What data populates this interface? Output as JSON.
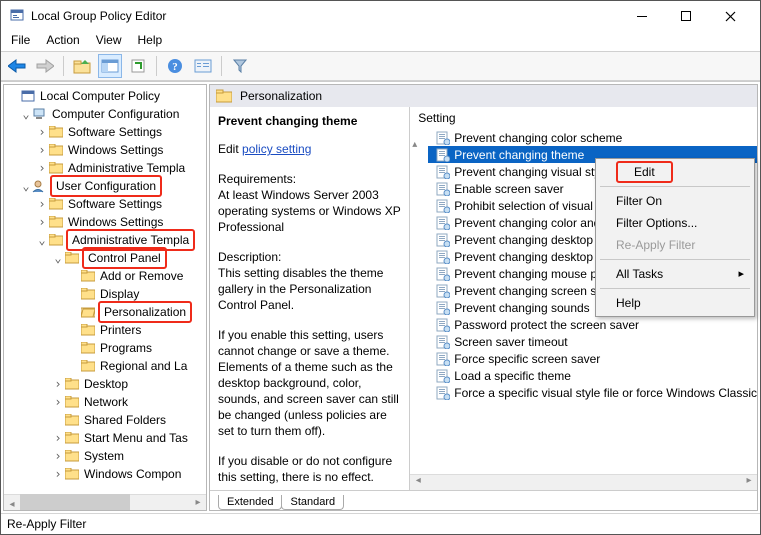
{
  "window": {
    "title": "Local Group Policy Editor",
    "menu": [
      "File",
      "Action",
      "View",
      "Help"
    ]
  },
  "tree": {
    "root": "Local Computer Policy",
    "computerConfig": "Computer Configuration",
    "cc_software": "Software Settings",
    "cc_windows": "Windows Settings",
    "cc_admin": "Administrative Templa",
    "userConfig": "User Configuration",
    "uc_software": "Software Settings",
    "uc_windows": "Windows Settings",
    "uc_admin": "Administrative Templa",
    "controlPanel": "Control Panel",
    "cp_add": "Add or Remove",
    "cp_display": "Display",
    "cp_personalization": "Personalization",
    "cp_printers": "Printers",
    "cp_programs": "Programs",
    "cp_regional": "Regional and La",
    "desktop": "Desktop",
    "network": "Network",
    "sharedFolders": "Shared Folders",
    "startMenu": "Start Menu and Tas",
    "system": "System",
    "winCompon": "Windows Compon"
  },
  "header": {
    "title": "Personalization"
  },
  "detail": {
    "title": "Prevent changing theme",
    "editPrefix": "Edit ",
    "editLink": "policy setting",
    "reqLabel": "Requirements:",
    "reqText": "At least Windows Server 2003 operating systems or Windows XP Professional",
    "descLabel": "Description:",
    "descText": "This setting disables the theme gallery in the Personalization Control Panel.",
    "p3": "If you enable this setting, users cannot change or save a theme. Elements of a theme such as the desktop background, color, sounds, and screen saver can still be changed (unless policies are set to turn them off).",
    "p4": "If you disable or do not configure this setting, there is no effect."
  },
  "settingsHeader": "Setting",
  "settings": [
    "Prevent changing color scheme",
    "Prevent changing theme",
    "Prevent changing visual style",
    "Enable screen saver",
    "Prohibit selection of visual",
    "Prevent changing color and",
    "Prevent changing desktop",
    "Prevent changing desktop",
    "Prevent changing mouse p",
    "Prevent changing screen saver",
    "Prevent changing sounds",
    "Password protect the screen saver",
    "Screen saver timeout",
    "Force specific screen saver",
    "Load a specific theme",
    "Force a specific visual style file or force Windows Classic"
  ],
  "context": {
    "edit": "Edit",
    "filterOn": "Filter On",
    "filterOptions": "Filter Options...",
    "reapply": "Re-Apply Filter",
    "allTasks": "All Tasks",
    "help": "Help"
  },
  "tabs": {
    "extended": "Extended",
    "standard": "Standard"
  },
  "status": "Re-Apply Filter"
}
